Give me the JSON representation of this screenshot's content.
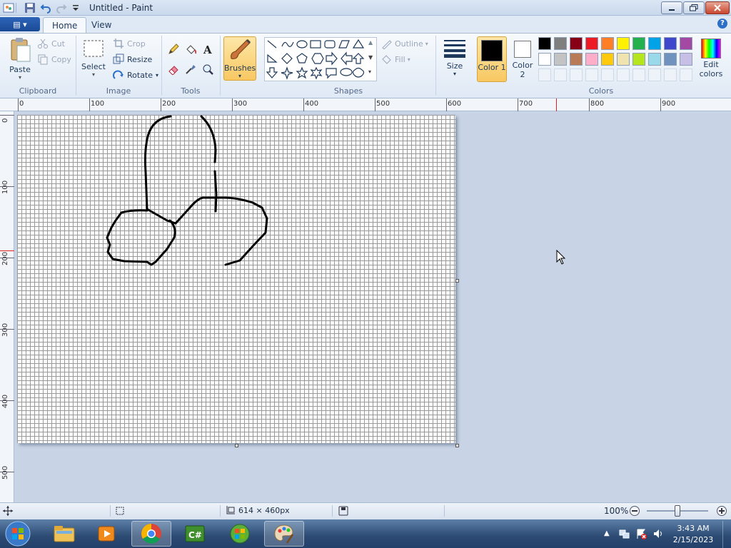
{
  "window": {
    "title": "Untitled - Paint"
  },
  "menu": {
    "file_label": "▤ ▾"
  },
  "tabs": [
    {
      "label": "Home"
    },
    {
      "label": "View"
    }
  ],
  "clipboard": {
    "group": "Clipboard",
    "paste": "Paste",
    "cut": "Cut",
    "copy": "Copy"
  },
  "image": {
    "group": "Image",
    "select": "Select",
    "crop": "Crop",
    "resize": "Resize",
    "rotate": "Rotate"
  },
  "tools": {
    "group": "Tools"
  },
  "brushes": {
    "label": "Brushes"
  },
  "shapes": {
    "group": "Shapes",
    "outline": "Outline",
    "fill": "Fill"
  },
  "size": {
    "label": "Size"
  },
  "colors": {
    "group": "Colors",
    "color1": "Color 1",
    "color2": "Color 2",
    "edit": "Edit colors",
    "color1_value": "#000000",
    "color2_value": "#ffffff",
    "palette_row1": [
      "#000000",
      "#7f7f7f",
      "#880015",
      "#ed1c24",
      "#ff7f27",
      "#fff200",
      "#22b14c",
      "#00a2e8",
      "#3f48cc",
      "#a349a4"
    ],
    "palette_row2": [
      "#ffffff",
      "#c3c3c3",
      "#b97a57",
      "#ffaec9",
      "#ffc90e",
      "#efe4b0",
      "#b5e61d",
      "#99d9ea",
      "#7092be",
      "#c8bfe7"
    ]
  },
  "ruler": {
    "h_ticks": [
      "0",
      "100",
      "200",
      "300",
      "400",
      "500",
      "600",
      "700",
      "800",
      "900"
    ],
    "v_ticks": [
      "0",
      "100",
      "200",
      "300",
      "400",
      "500"
    ]
  },
  "status": {
    "canvas_size": "614 × 460px",
    "zoom": "100%"
  },
  "taskbar": {
    "time": "3:43 AM",
    "date": "2/15/2023"
  }
}
